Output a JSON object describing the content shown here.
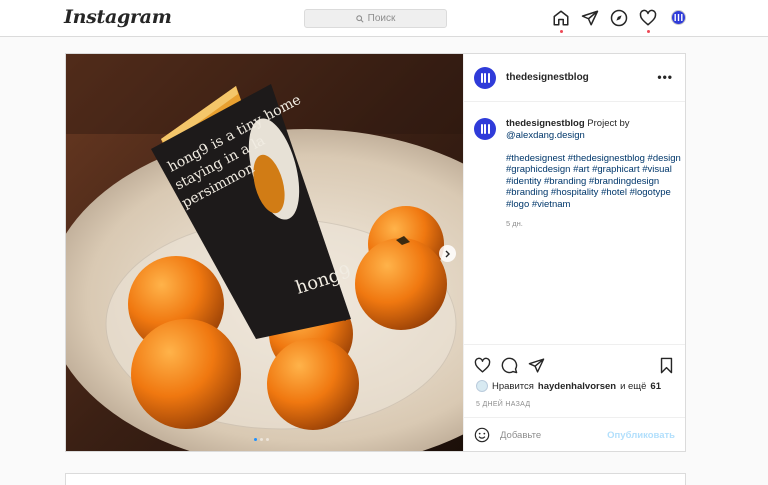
{
  "nav": {
    "logo": "Instagram",
    "search_placeholder": "Поиск"
  },
  "post": {
    "username": "thedesignestblog",
    "more_label": "•••",
    "photo_text": {
      "line1": "hong9 is a tiny home",
      "line2": "staying in a la",
      "line3": "persimmon",
      "brand": "hong9"
    },
    "caption": {
      "username": "thedesignestblog",
      "text": "Project by",
      "mention": "@alexdang.design",
      "hashtags": "#thedesignest #thedesignestblog #design #graphicdesign #art #graphicart #visual #identity #branding #brandingdesign #branding #hospitality #hotel #logotype #logo #vietnam",
      "time": "5 дн."
    },
    "likes": {
      "prefix": "Нравится",
      "user": "haydenhalvorsen",
      "middle": "и ещё",
      "count": "61"
    },
    "posted_ago": "5 ДНЕЙ НАЗАД",
    "comment_placeholder": "Добавьте",
    "publish_label": "Опубликовать",
    "carousel_dots": 3,
    "carousel_active": 1
  },
  "colors": {
    "accent": "#0095f6",
    "avatar_blue": "#2f3bd9",
    "publish_disabled": "#b2dffc",
    "notification_dot": "#ed4956"
  }
}
